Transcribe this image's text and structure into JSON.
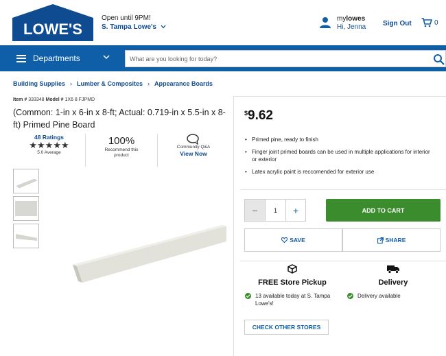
{
  "header": {
    "logo_text": "LOWE'S",
    "store_hours": "Open until 9PM!",
    "store_name": "S. Tampa Lowe's",
    "mylowes_prefix": "my",
    "mylowes_brand": "lowes",
    "greeting": "Hi,  Jenna",
    "sign_out": "Sign Out",
    "cart_count": "0"
  },
  "nav": {
    "departments_label": "Departments",
    "search_placeholder": "What are you looking for today?"
  },
  "breadcrumb": [
    "Building Supplies",
    "Lumber & Composites",
    "Appearance Boards"
  ],
  "product": {
    "item_label": "Item #",
    "item_number": "333348",
    "model_label": "Model #",
    "model_number": "1X6 8 FJPMD",
    "title": "(Common: 1-in x 6-in x 8-ft; Actual: 0.719-in x 5.5-in x 8-ft) Primed Pine Board",
    "ratings_link": "48 Ratings",
    "stars": "★★★★★",
    "average": "5.0 Average",
    "recommend_pct": "100%",
    "recommend_label": "Recommend this product",
    "qa_label": "Community Q&A",
    "view_now": "View Now"
  },
  "purchase": {
    "currency": "$",
    "price": "9.62",
    "bullets": [
      "Primed pine, ready to finish",
      "Finger joint primed boards can be used in multiple applications for interior or exterior",
      "Latex acrylic paint is reccomended for exterior use"
    ],
    "qty_minus": "−",
    "qty_value": "1",
    "qty_plus": "+",
    "add_to_cart": "ADD TO CART",
    "save": "SAVE",
    "share": "SHARE",
    "pickup_title": "FREE Store Pickup",
    "pickup_avail": "13 available today at S. Tampa Lowe's!",
    "delivery_title": "Delivery",
    "delivery_avail": "Delivery available",
    "check_stores": "CHECK OTHER STORES"
  },
  "colors": {
    "brand_blue": "#0f4b91",
    "nav_blue": "#0f5ea8",
    "cart_green": "#3a8c2c"
  },
  "icons": [
    "hamburger-icon",
    "chevron-down-icon",
    "search-icon",
    "user-icon",
    "cart-icon",
    "chat-icon",
    "heart-icon",
    "share-icon",
    "store-box-icon",
    "truck-icon",
    "check-icon"
  ]
}
